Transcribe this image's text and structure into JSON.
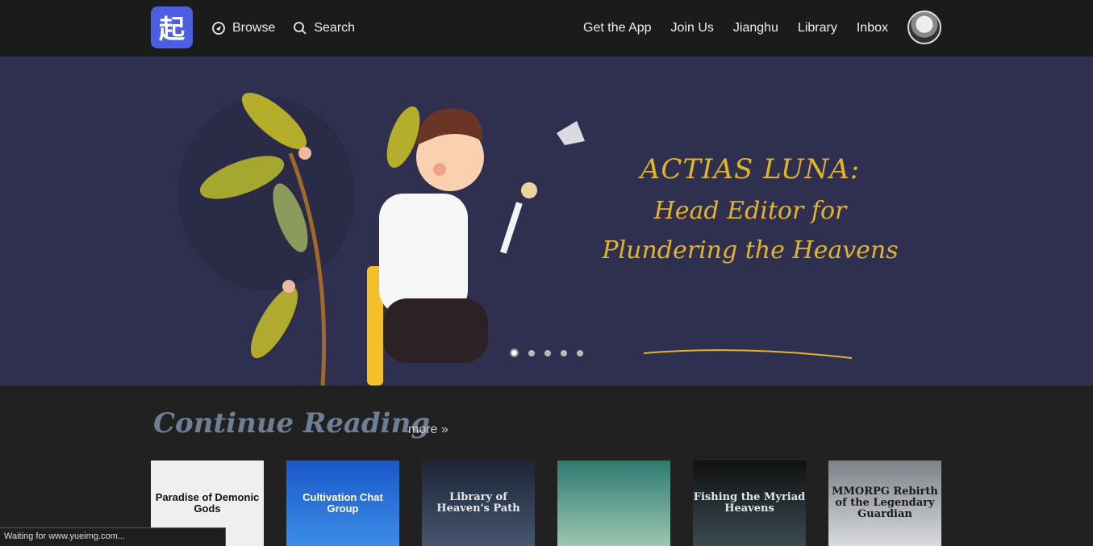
{
  "nav": {
    "logo_glyph": "起",
    "left": [
      {
        "label": "Browse",
        "icon": "compass-icon"
      },
      {
        "label": "Search",
        "icon": "search-icon"
      }
    ],
    "right": [
      "Get the App",
      "Join Us",
      "Jianghu",
      "Library",
      "Inbox"
    ]
  },
  "banner": {
    "line1": "ACTIAS LUNA:",
    "line2": "Head Editor for",
    "line3": "Plundering the Heavens",
    "slide_count": 5,
    "active_slide": 1,
    "accent_color": "#e3b42a",
    "background_color": "#2f3050"
  },
  "continue_reading": {
    "title": "Continue Reading",
    "more": "more »",
    "books": [
      {
        "title": "Paradise of Demonic Gods"
      },
      {
        "title": "Cultivation Chat Group"
      },
      {
        "title": "Library of Heaven's Path"
      },
      {
        "title": ""
      },
      {
        "title": "Fishing the Myriad Heavens"
      },
      {
        "title": "MMORPG Rebirth of the Legendary Guardian"
      }
    ]
  },
  "status_bar": "Waiting for www.yueimg.com..."
}
